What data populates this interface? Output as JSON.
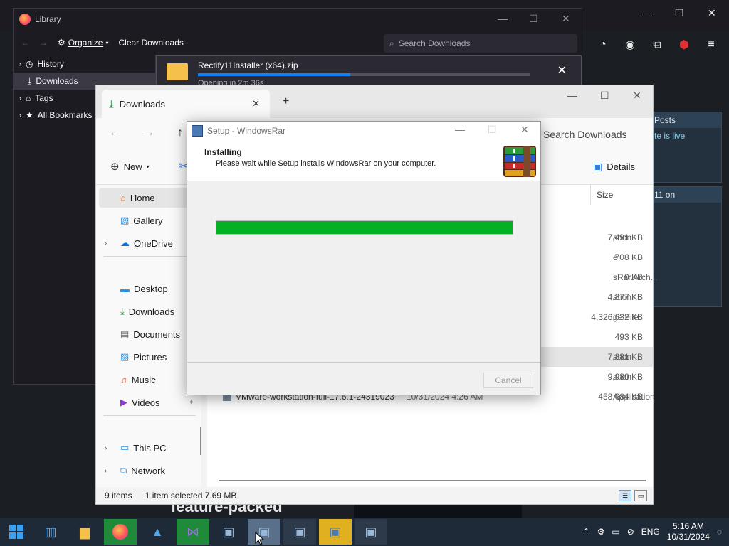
{
  "firefox": {
    "window_controls": {
      "minimize": "—",
      "restore": "❐",
      "close": "✕"
    },
    "toolbar_icons": [
      "shield-icon",
      "account-icon",
      "extensions-icon",
      "ublock-icon",
      "menu-icon"
    ],
    "bg_cards": [
      "Posts",
      "te is live",
      "11 on"
    ],
    "bg_featured_text": "feature-packed"
  },
  "library": {
    "title": "Library",
    "toolbar": {
      "organize": "Organize",
      "clear_downloads": "Clear Downloads"
    },
    "search_placeholder": "Search Downloads",
    "sidebar": [
      {
        "label": "History",
        "icon": "clock-icon",
        "selected": false
      },
      {
        "label": "Downloads",
        "icon": "download-icon",
        "selected": true
      },
      {
        "label": "Tags",
        "icon": "tag-icon",
        "selected": false
      },
      {
        "label": "All Bookmarks",
        "icon": "star-icon",
        "selected": false
      }
    ],
    "download": {
      "filename": "Rectify11Installer (x64).zip",
      "progress_percent": 46,
      "status": "Opening in 2m 36s"
    }
  },
  "explorer": {
    "tab_title": "Downloads",
    "search_placeholder": "Search Downloads",
    "cmd": {
      "new_label": "New",
      "details_label": "Details"
    },
    "column_size": "Size",
    "nav_items": [
      {
        "label": "Home",
        "icon": "home-icon",
        "selected": true
      },
      {
        "label": "Gallery",
        "icon": "gallery-icon"
      },
      {
        "label": "OneDrive",
        "icon": "cloud-icon",
        "chevron": true
      },
      {
        "label": "Desktop",
        "icon": "desktop-icon"
      },
      {
        "label": "Downloads",
        "icon": "download-icon"
      },
      {
        "label": "Documents",
        "icon": "document-icon"
      },
      {
        "label": "Pictures",
        "icon": "pictures-icon"
      },
      {
        "label": "Music",
        "icon": "music-icon"
      },
      {
        "label": "Videos",
        "icon": "video-icon"
      },
      {
        "label": "This PC",
        "icon": "pc-icon",
        "chevron": true
      },
      {
        "label": "Network",
        "icon": "network-icon",
        "chevron": true
      }
    ],
    "rows": [
      {
        "name": "",
        "date": "",
        "type": "ation",
        "size": "7,491 KB"
      },
      {
        "name": "",
        "date": "",
        "type": "e",
        "size": "708 KB"
      },
      {
        "name": "",
        "date": "",
        "type": "sRar.Arch...",
        "size": "0 KB"
      },
      {
        "name": "",
        "date": "",
        "type": "ation",
        "size": "4,877 KB"
      },
      {
        "name": "",
        "date": "",
        "type": "ge File",
        "size": "4,326,632 KB"
      },
      {
        "name": "",
        "date": "",
        "type": "",
        "size": "493 KB"
      },
      {
        "name": "",
        "date": "",
        "type": "ation",
        "size": "7,881 KB",
        "selected": true
      },
      {
        "name": "",
        "date": "",
        "type": "ation",
        "size": "9,980 KB"
      },
      {
        "name": "VMware-workstation-full-17.6.1-24319023",
        "date": "10/31/2024 4:26 AM",
        "type": "Application",
        "size": "458,684 KB"
      }
    ],
    "status": {
      "items": "9 items",
      "selected": "1 item selected  7.69 MB"
    }
  },
  "setup": {
    "title": "Setup - WindowsRar",
    "heading": "Installing",
    "subheading": "Please wait while Setup installs WindowsRar on your computer.",
    "progress_percent": 100,
    "cancel_label": "Cancel"
  },
  "taskbar": {
    "apps": [
      "start-icon",
      "file-explorer-icon",
      "folder-icon",
      "firefox-icon",
      "photos-icon",
      "visual-studio-icon",
      "setup-icon",
      "setup-icon",
      "setup-icon",
      "setup-icon",
      "setup-icon"
    ],
    "tray": {
      "language": "ENG",
      "time": "5:16 AM",
      "date": "10/31/2024"
    }
  },
  "colors": {
    "progress_green": "#06b025",
    "firefox_progress": "#0a84ff",
    "taskbar_bg": "#1f2a38"
  }
}
